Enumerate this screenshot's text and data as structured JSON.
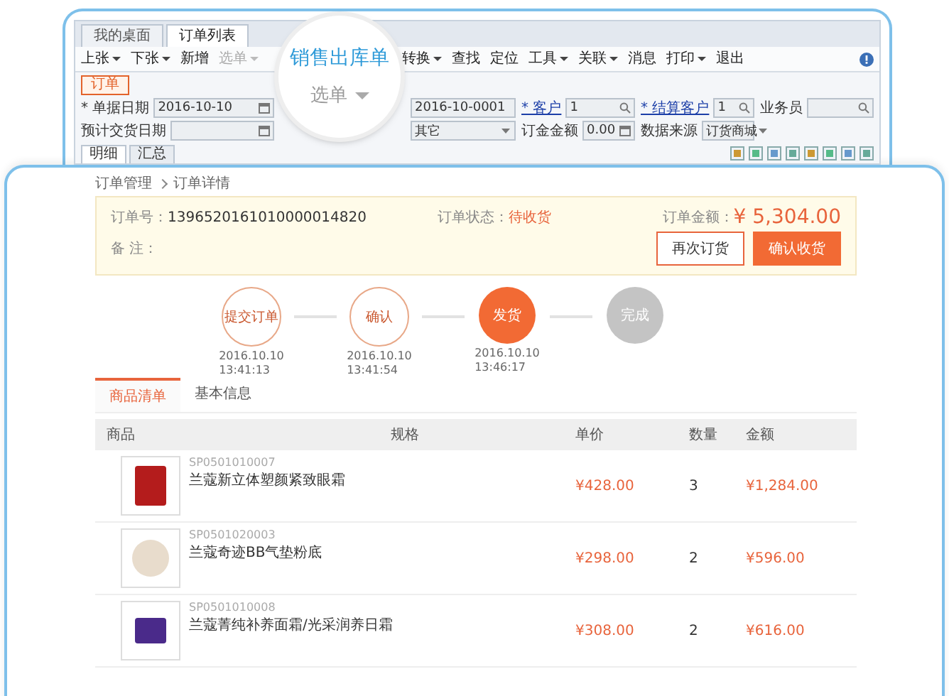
{
  "erp_window": {
    "tabs": [
      {
        "label": "我的桌面",
        "selected": false
      },
      {
        "label": "订单列表",
        "selected": true
      }
    ],
    "toolbar_left": [
      {
        "label": "上张",
        "menu": true,
        "disabled": false
      },
      {
        "label": "下张",
        "menu": true,
        "disabled": false
      },
      {
        "label": "新增",
        "menu": false,
        "disabled": false
      },
      {
        "label": "选单",
        "menu": true,
        "disabled": true
      }
    ],
    "toolbar_right": [
      {
        "label": "转换",
        "menu": true,
        "disabled": false
      },
      {
        "label": "查找",
        "menu": false,
        "disabled": false
      },
      {
        "label": "定位",
        "menu": false,
        "disabled": false
      },
      {
        "label": "工具",
        "menu": true,
        "disabled": false
      },
      {
        "label": "关联",
        "menu": true,
        "disabled": false
      },
      {
        "label": "消息",
        "menu": false,
        "disabled": false
      },
      {
        "label": "打印",
        "menu": true,
        "disabled": false
      },
      {
        "label": "退出",
        "menu": false,
        "disabled": false
      }
    ],
    "doc_tag": "订单",
    "field_rows": [
      [
        {
          "label": "* 单据日期",
          "value": "2016-10-10",
          "kind": "date",
          "link": false
        },
        {
          "value": "2016-10-0001",
          "kind": "text"
        },
        {
          "label": "* 客户",
          "value": "1",
          "kind": "lookup",
          "link": true
        },
        {
          "label": "* 结算客户",
          "value": "1",
          "kind": "lookup",
          "link": true
        },
        {
          "label": "业务员",
          "kind": "lookup",
          "link": false
        }
      ],
      [
        {
          "label": "预计交货日期",
          "kind": "date",
          "link": false
        },
        {
          "value": "其它",
          "kind": "select"
        },
        {
          "label": "订金金额",
          "value": "0.00",
          "kind": "date",
          "link": false
        },
        {
          "label": "数据来源",
          "value": "订货商城",
          "kind": "select",
          "link": false
        }
      ]
    ],
    "detail_tabs": [
      {
        "label": "明细",
        "selected": true
      },
      {
        "label": "汇总",
        "selected": false
      }
    ]
  },
  "magnifier": {
    "title": "销售出库单",
    "button": "选单"
  },
  "breadcrumb": [
    "订单管理",
    "订单详情"
  ],
  "order": {
    "number_label": "订单号：",
    "number": "1396520161010000014820",
    "status_label": "订单状态：",
    "status": "待收货",
    "amount_label": "订单金额：",
    "amount": "¥ 5,304.00",
    "note_label": "备 注："
  },
  "buttons": [
    {
      "label": "再次订货",
      "kind": "secondary"
    },
    {
      "label": "确认收货",
      "kind": "primary"
    }
  ],
  "steps": [
    {
      "label": "提交订单",
      "kind": "done",
      "date": "2016.10.10",
      "time": "13:41:13"
    },
    {
      "label": "确认",
      "kind": "done",
      "date": "2016.10.10",
      "time": "13:41:54"
    },
    {
      "label": "发货",
      "kind": "current",
      "date": "2016.10.10",
      "time": "13:46:17"
    },
    {
      "label": "完成",
      "kind": "pending"
    }
  ],
  "tabs": [
    {
      "label": "商品清单",
      "selected": true
    },
    {
      "label": "基本信息",
      "selected": false
    }
  ],
  "table": {
    "columns": [
      "商品",
      "规格",
      "单价",
      "数量",
      "金额"
    ],
    "rows": [
      {
        "code": "SP0501010007",
        "name": "兰蔻新立体塑颜紧致眼霜",
        "price": "¥428.00",
        "qty": "3",
        "total": "¥1,284.00"
      },
      {
        "code": "SP0501020003",
        "name": "兰蔻奇迹BB气垫粉底",
        "price": "¥298.00",
        "qty": "2",
        "total": "¥596.00"
      },
      {
        "code": "SP0501010008",
        "name": "兰蔻菁纯补养面霜/光采润养日霜",
        "price": "¥308.00",
        "qty": "2",
        "total": "¥616.00"
      }
    ]
  }
}
